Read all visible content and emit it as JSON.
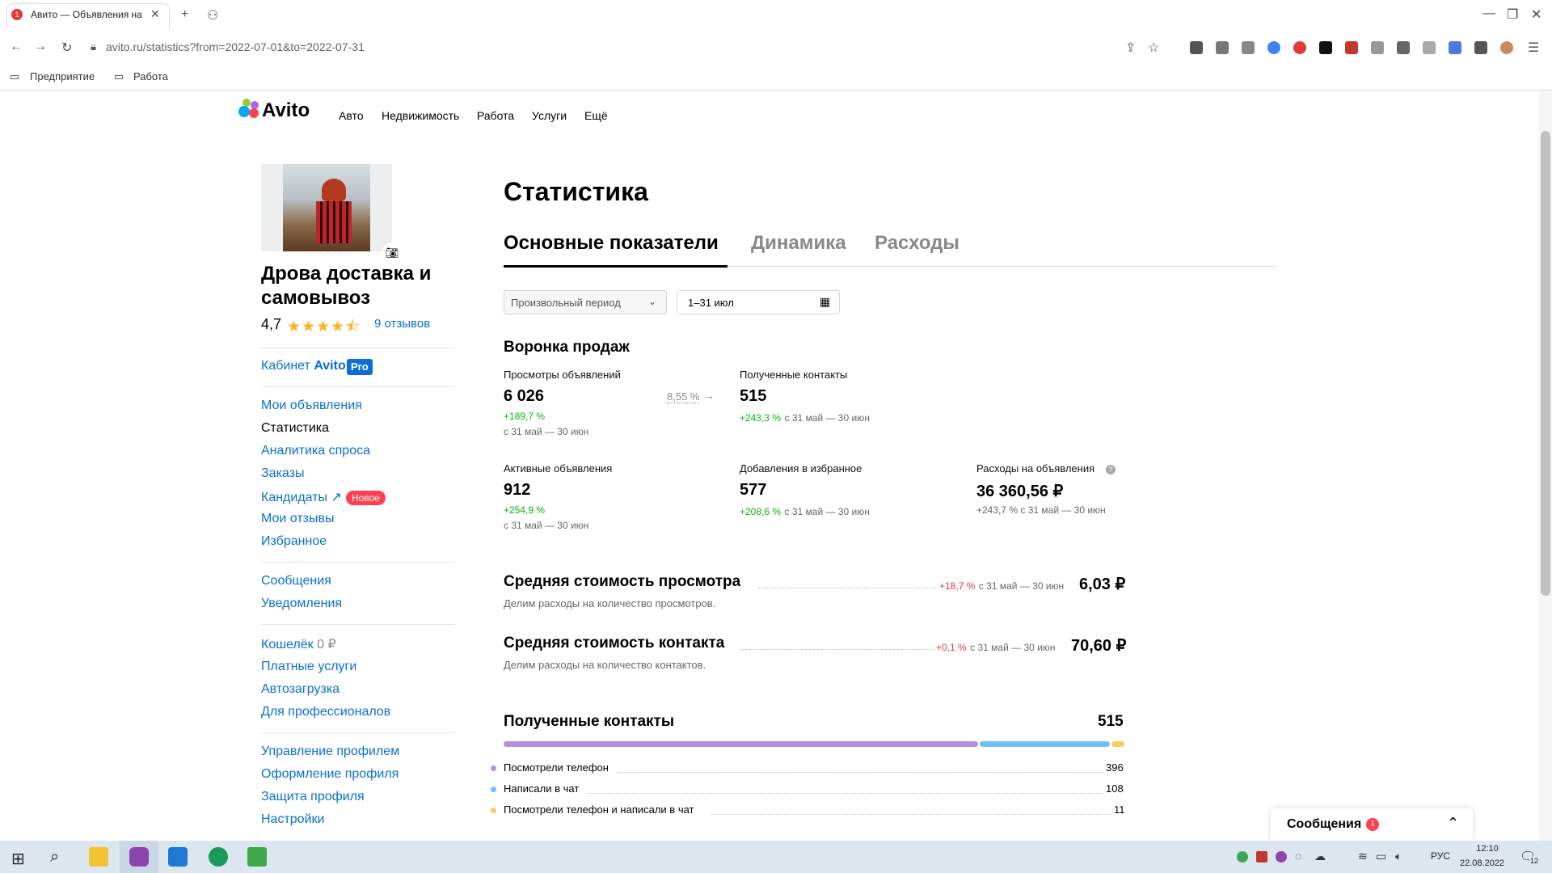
{
  "browser": {
    "tab_title": "Авито — Объявления на сай",
    "tab_badge": "1",
    "url": "avito.ru/statistics?from=2022-07-01&to=2022-07-31",
    "bookmarks": [
      "Предприятие",
      "Работа"
    ]
  },
  "header": {
    "logo": "Avito",
    "nav": [
      "Авто",
      "Недвижимость",
      "Работа",
      "Услуги",
      "Ещё"
    ]
  },
  "profile": {
    "name_line1": "Дрова доставка и",
    "name_line2": "самовывоз",
    "rating": "4,7",
    "reviews": "9 отзывов",
    "rating_stars": 4.5
  },
  "sidebar": {
    "cabinet": "Кабинет",
    "cabinet_brand": "Avito",
    "cabinet_pro": "Pro",
    "group1": [
      "Мои объявления",
      "Статистика",
      "Аналитика спроса",
      "Заказы",
      "Кандидаты",
      "Мои отзывы",
      "Избранное"
    ],
    "new_badge": "Новое",
    "group2": [
      "Сообщения",
      "Уведомления"
    ],
    "wallet": "Кошелёк",
    "wallet_value": "0 ₽",
    "group3": [
      "Платные услуги",
      "Автозагрузка",
      "Для профессионалов"
    ],
    "group4": [
      "Управление профилем",
      "Оформление профиля",
      "Защита профиля",
      "Настройки"
    ]
  },
  "main": {
    "title": "Статистика",
    "tabs": [
      "Основные показатели",
      "Динамика",
      "Расходы"
    ],
    "period_select": "Произвольный период",
    "date_range": "1–31 июл",
    "funnel_title": "Воронка продаж",
    "metrics": [
      {
        "label": "Просмотры объявлений",
        "value": "6 026",
        "delta": "+189,7 %",
        "period": "с 31 май — 30 июн"
      },
      {
        "label": "Полученные контакты",
        "value": "515",
        "delta": "+243,3 %",
        "period": "с 31 май — 30 июн"
      },
      {
        "label": "Активные объявления",
        "value": "912",
        "delta": "+254,9 %",
        "period": "с 31 май — 30 июн"
      },
      {
        "label": "Добавления в избранное",
        "value": "577",
        "delta": "+208,6 %",
        "period": "с 31 май — 30 июн"
      },
      {
        "label": "Расходы на объявления",
        "value": "36 360,56 ₽",
        "delta": "+243,7 %",
        "period": "с 31 май — 30 июн"
      }
    ],
    "conversion": "8,55 %",
    "avg_view": {
      "title": "Средняя стоимость просмотра",
      "desc": "Делим расходы на количество просмотров.",
      "delta": "+18,7 %",
      "period": "с 31 май — 30 июн",
      "value": "6,03 ₽"
    },
    "avg_contact": {
      "title": "Средняя стоимость контакта",
      "desc": "Делим расходы на количество контактов.",
      "delta": "+0,1 %",
      "period": "с 31 май — 30 июн",
      "value": "70,60 ₽"
    },
    "contacts": {
      "title": "Полученные контакты",
      "total": "515",
      "items": [
        {
          "label": "Посмотрели телефон",
          "value": "396",
          "color": "#b48fe0"
        },
        {
          "label": "Написали в чат",
          "value": "108",
          "color": "#6ec1f5"
        },
        {
          "label": "Посмотрели телефон и написали в чат",
          "value": "11",
          "color": "#f5cf5c"
        }
      ]
    }
  },
  "messages_widget": {
    "label": "Сообщения",
    "badge": "1"
  },
  "taskbar": {
    "lang": "РУС",
    "time": "12:10",
    "date": "22.08.2022",
    "notif": "12"
  }
}
